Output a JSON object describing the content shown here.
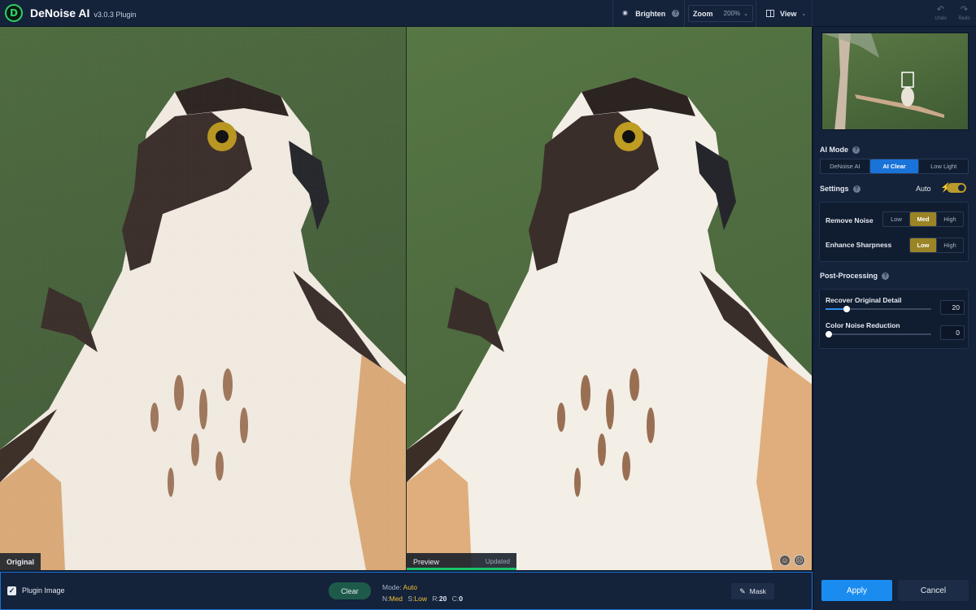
{
  "app": {
    "name": "DeNoise AI",
    "version": "v3.0.3 Plugin",
    "logo_letter": "D"
  },
  "toolbar": {
    "brighten_label": "Brighten",
    "zoom_label": "Zoom",
    "zoom_value": "200%",
    "view_label": "View",
    "undo_label": "Undo",
    "redo_label": "Redo"
  },
  "panes": {
    "original_label": "Original",
    "preview_label": "Preview",
    "preview_status": "Updated"
  },
  "sidebar": {
    "ai_mode": {
      "title": "AI Mode",
      "options": [
        "DeNoise AI",
        "AI Clear",
        "Low Light"
      ],
      "selected": "AI Clear"
    },
    "settings": {
      "title": "Settings",
      "auto_label": "Auto",
      "auto_enabled": true,
      "remove_noise": {
        "label": "Remove Noise",
        "options": [
          "Low",
          "Med",
          "High"
        ],
        "selected": "Med"
      },
      "enhance_sharpness": {
        "label": "Enhance Sharpness",
        "options": [
          "Low",
          "High"
        ],
        "selected": "Low"
      }
    },
    "post_processing": {
      "title": "Post-Processing",
      "recover_detail": {
        "label": "Recover Original Detail",
        "value": "20",
        "fraction": 0.2
      },
      "color_noise": {
        "label": "Color Noise Reduction",
        "value": "0",
        "fraction": 0.0
      }
    },
    "apply_label": "Apply",
    "cancel_label": "Cancel"
  },
  "bottombar": {
    "plugin_image_label": "Plugin Image",
    "plugin_image_checked": true,
    "clear_label": "Clear",
    "mode_prefix": "Mode:",
    "mode_value": "Auto",
    "n_label": "N:",
    "n_value": "Med",
    "s_label": "S:",
    "s_value": "Low",
    "r_label": "R:",
    "r_value": "20",
    "c_label": "C:",
    "c_value": "0",
    "mask_label": "Mask"
  },
  "colors": {
    "accent_blue": "#1a8cf0",
    "accent_gold": "#9a8426",
    "success_green": "#19c36a",
    "panel_bg": "#14223a"
  }
}
